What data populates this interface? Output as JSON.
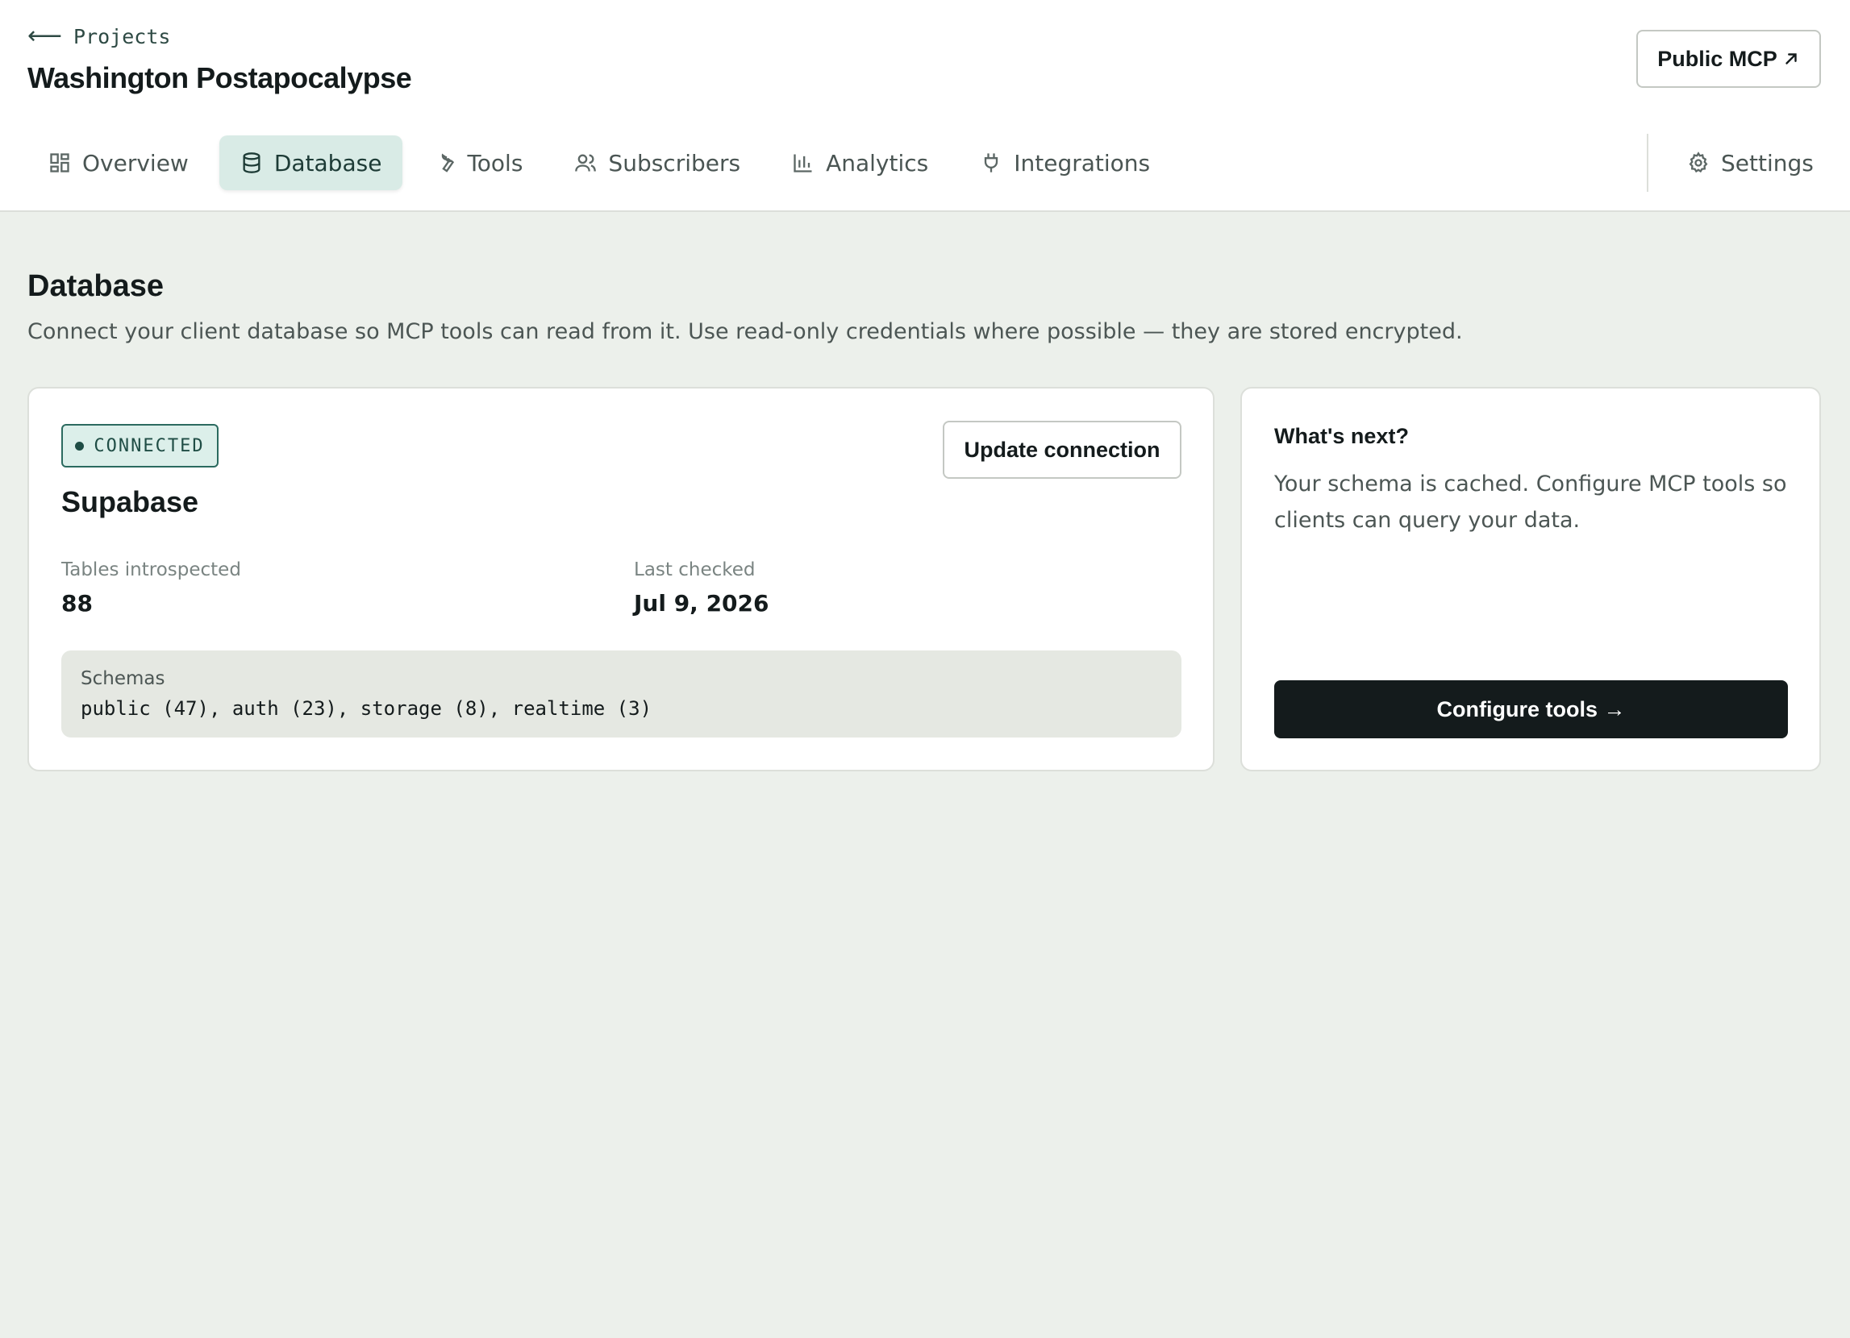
{
  "header": {
    "back_label": "Projects",
    "back_icon": "arrow-left-icon",
    "project_title": "Washington Postapocalypse",
    "public_mcp_label": "Public MCP",
    "public_mcp_icon": "arrow-up-right-icon"
  },
  "nav": {
    "tabs": [
      {
        "label": "Overview",
        "icon": "grid-icon",
        "active": false
      },
      {
        "label": "Database",
        "icon": "database-icon",
        "active": true
      },
      {
        "label": "Tools",
        "icon": "wrench-icon",
        "active": false
      },
      {
        "label": "Subscribers",
        "icon": "users-icon",
        "active": false
      },
      {
        "label": "Analytics",
        "icon": "bar-chart-icon",
        "active": false
      },
      {
        "label": "Integrations",
        "icon": "plug-icon",
        "active": false
      }
    ],
    "settings_label": "Settings",
    "settings_icon": "gear-icon"
  },
  "page": {
    "title": "Database",
    "description": "Connect your client database so MCP tools can read from it. Use read-only credentials where possible — they are stored encrypted."
  },
  "connection": {
    "status": "CONNECTED",
    "provider": "Supabase",
    "update_label": "Update connection",
    "tables_label": "Tables introspected",
    "tables_value": "88",
    "last_checked_label": "Last checked",
    "last_checked_value": "Jul 9, 2026",
    "schemas_label": "Schemas",
    "schemas_value": "public (47), auth (23), storage (8), realtime (3)"
  },
  "next": {
    "title": "What's next?",
    "body": "Your schema is cached. Configure MCP tools so clients can query your data.",
    "button_label": "Configure tools →"
  },
  "colors": {
    "background": "#ecf0eb",
    "accent": "#d9ebe6",
    "primary_button": "#141b1c",
    "status_border": "#2b6a5f"
  }
}
